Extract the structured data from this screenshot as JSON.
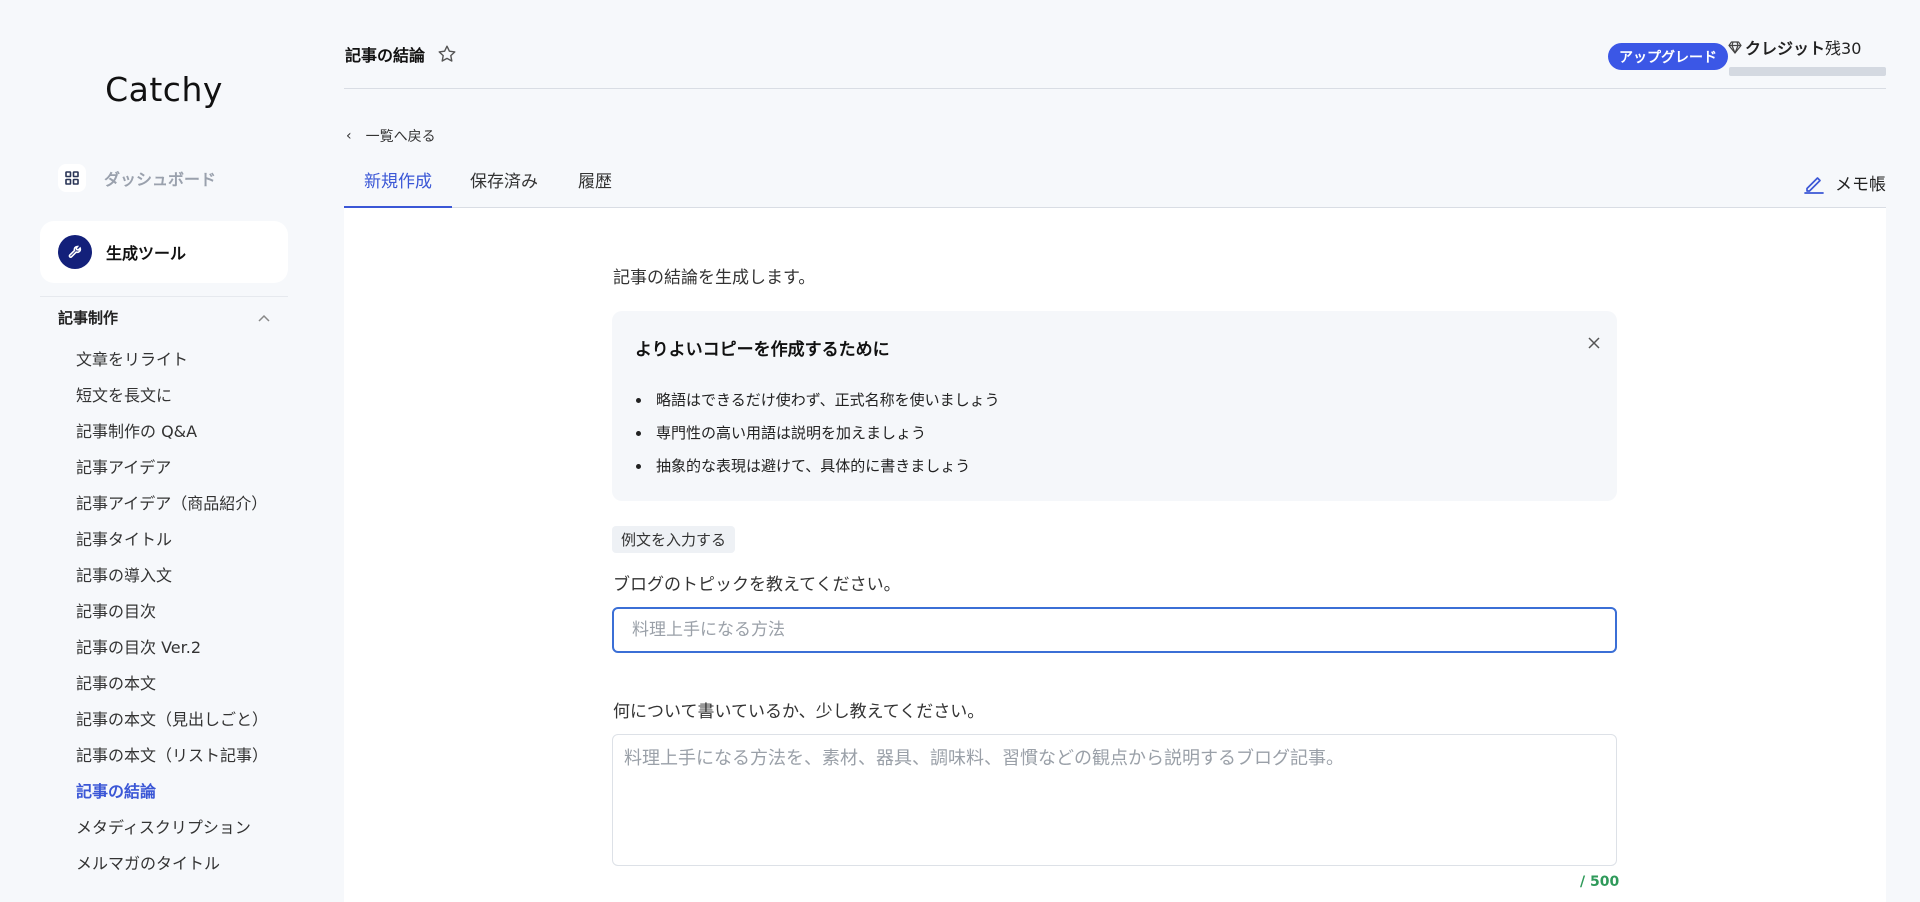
{
  "sidebar": {
    "logo": "Catchy",
    "dashboard_label": "ダッシュボード",
    "tools_label": "生成ツール",
    "section_title": "記事制作",
    "items": [
      {
        "label": "文章をリライト"
      },
      {
        "label": "短文を長文に"
      },
      {
        "label": "記事制作の Q&A"
      },
      {
        "label": "記事アイデア"
      },
      {
        "label": "記事アイデア（商品紹介）"
      },
      {
        "label": "記事タイトル"
      },
      {
        "label": "記事の導入文"
      },
      {
        "label": "記事の目次"
      },
      {
        "label": "記事の目次 Ver.2"
      },
      {
        "label": "記事の本文"
      },
      {
        "label": "記事の本文（見出しごと）"
      },
      {
        "label": "記事の本文（リスト記事）"
      },
      {
        "label": "記事の結論",
        "active": true
      },
      {
        "label": "メタディスクリプション"
      },
      {
        "label": "メルマガのタイトル"
      }
    ]
  },
  "header": {
    "title": "記事の結論",
    "upgrade_label": "アップグレード",
    "credits_label": "クレジット",
    "credits_remaining": "残30",
    "credits_fill": 1.0
  },
  "nav": {
    "back_label": "一覧へ戻る",
    "tabs": [
      {
        "label": "新規作成",
        "active": true
      },
      {
        "label": "保存済み"
      },
      {
        "label": "履歴"
      }
    ],
    "memo_label": "メモ帳"
  },
  "main": {
    "intro": "記事の結論を生成します。",
    "tips_title": "よりよいコピーを作成するために",
    "tips": [
      "略語はできるだけ使わず、正式名称を使いましょう",
      "専門性の高い用語は説明を加えましょう",
      "抽象的な表現は避けて、具体的に書きましょう"
    ],
    "example_label": "例文を入力する",
    "topic_label": "ブログのトピックを教えてください。",
    "topic_placeholder": "料理上手になる方法",
    "topic_value": "",
    "about_label": "何について書いているか、少し教えてください。",
    "about_placeholder": "料理上手になる方法を、素材、器具、調味料、習慣などの観点から説明するブログ記事。",
    "about_value": "",
    "char_count": "/ 500"
  },
  "colors": {
    "accent": "#3b57d6",
    "upgrade_bg": "#3b57e6",
    "tool_icon_bg": "#13207a",
    "char_count": "#2f9a5a"
  },
  "icons": {
    "dashboard": "grid-icon",
    "tools": "wrench-icon",
    "favorite": "star-icon",
    "credits": "diamond-icon",
    "collapse": "chevron-up-icon",
    "back": "chevron-left-icon",
    "memo": "pencil-icon",
    "close": "close-icon"
  }
}
